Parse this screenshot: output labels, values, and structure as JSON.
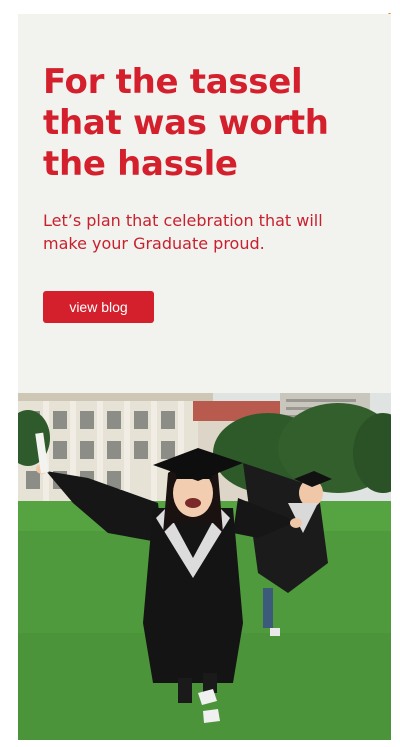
{
  "hero": {
    "headline": "For the tassel\nthat was worth\nthe hassle",
    "subtext": "Let’s plan that celebration that will\nmake your Graduate proud.",
    "cta_label": "view blog"
  },
  "photo": {
    "description_icon": "graduates-photo"
  },
  "colors": {
    "brand_red": "#d4202c",
    "hero_background": "#f2f3ef"
  }
}
